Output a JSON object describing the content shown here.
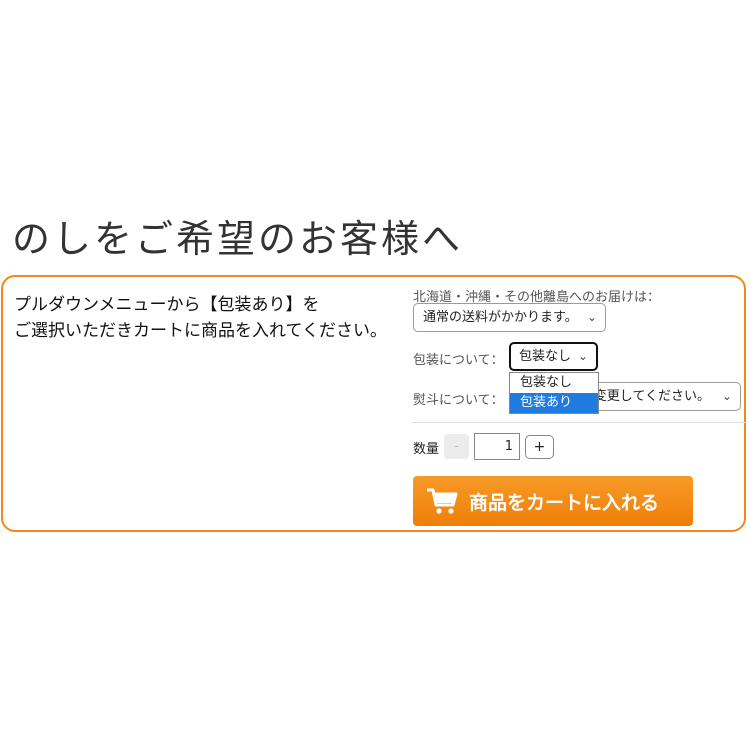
{
  "heading": "のしをご希望のお客様へ",
  "intro": {
    "line1": "プルダウンメニューから【包装あり】を",
    "line2": "ご選択いただきカートに商品を入れてください。"
  },
  "shipping": {
    "label": "北海道・沖縄・その他離島へのお届けは：",
    "value": "通常の送料がかかります。"
  },
  "wrapping": {
    "label": "包装について：",
    "value": "包装なし",
    "options": [
      "包装なし",
      "包装あり"
    ]
  },
  "noshi": {
    "label": "熨斗について：",
    "value": "変更してください。"
  },
  "quantity": {
    "label": "数量",
    "minus": "-",
    "value": "1",
    "plus": "+"
  },
  "cart_button": {
    "label": "商品をカートに入れる",
    "icon": "cart-icon"
  },
  "colors": {
    "accent": "#ee8a1a",
    "button": "#f08a12",
    "selected_option": "#1f7be0"
  }
}
